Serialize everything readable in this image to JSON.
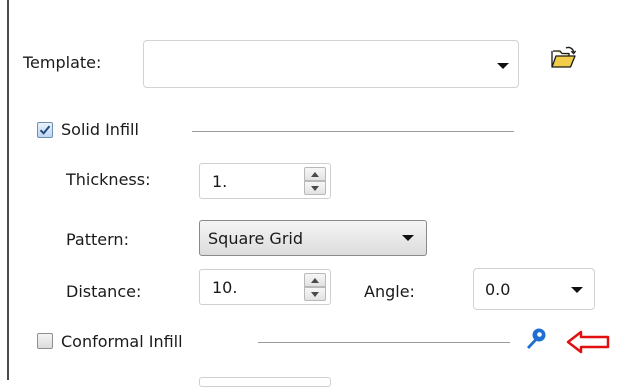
{
  "template": {
    "label": "Template:",
    "value": "",
    "open_icon": "open-folder-icon"
  },
  "solid_infill": {
    "checkbox_label": "Solid Infill",
    "checked": true,
    "thickness": {
      "label": "Thickness:",
      "value": "1."
    },
    "pattern": {
      "label": "Pattern:",
      "value": "Square Grid"
    },
    "distance": {
      "label": "Distance:",
      "value": "10."
    },
    "angle": {
      "label": "Angle:",
      "value": "0.0"
    }
  },
  "conformal_infill": {
    "checkbox_label": "Conformal Infill",
    "checked": false,
    "settings_icon": "wrench-icon",
    "annotation_icon": "left-arrow-icon"
  },
  "colors": {
    "accent_blue": "#1e6fd1",
    "annotation_red": "#e01010"
  }
}
